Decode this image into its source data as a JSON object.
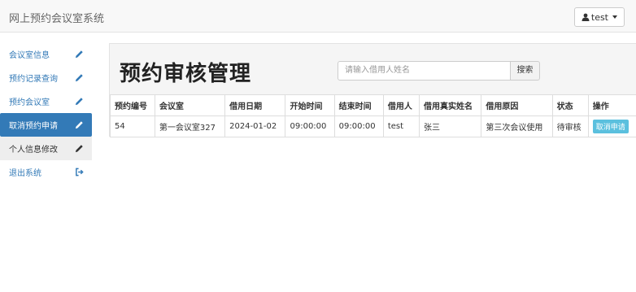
{
  "navbar": {
    "brand": "网上预约会议室系统",
    "user_label": "test"
  },
  "sidebar": {
    "items": [
      {
        "label": "会议室信息",
        "icon": "pencil-icon"
      },
      {
        "label": "预约记录查询",
        "icon": "pencil-icon"
      },
      {
        "label": "预约会议室",
        "icon": "pencil-icon"
      },
      {
        "label": "取消预约申请",
        "icon": "pencil-icon",
        "state": "active"
      },
      {
        "label": "个人信息修改",
        "icon": "pencil-icon",
        "state": "hover"
      },
      {
        "label": "退出系统",
        "icon": "logout-icon"
      }
    ]
  },
  "main": {
    "title": "预约审核管理",
    "search_placeholder": "请输入借用人姓名",
    "search_button": "搜索",
    "table": {
      "headers": [
        "预约编号",
        "会议室",
        "借用日期",
        "开始时间",
        "结束时间",
        "借用人",
        "借用真实姓名",
        "借用原因",
        "状态",
        "操作"
      ],
      "rows": [
        [
          "54",
          "第一会议室327",
          "2024-01-02",
          "09:00:00",
          "09:00:00",
          "test",
          "张三",
          "第三次会议使用",
          "待审核",
          "取消申请"
        ]
      ]
    }
  },
  "colors": {
    "primary": "#337ab7",
    "action_button": "#5bc0de"
  }
}
